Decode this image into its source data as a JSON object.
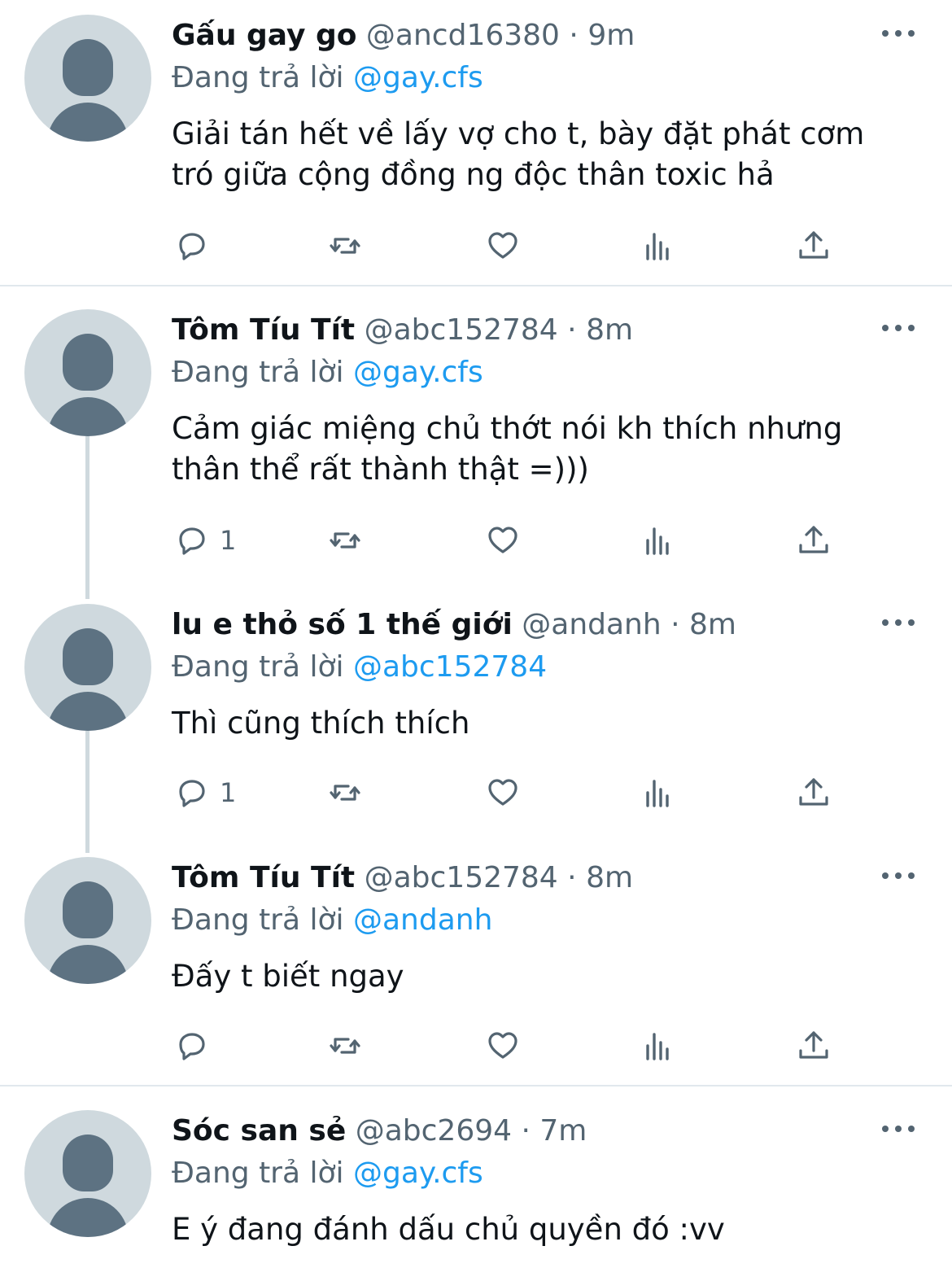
{
  "tweets": [
    {
      "name": "Gấu gay go",
      "handle": "@ancd16380",
      "time": "9m",
      "reply_prefix": "Đang trả lời",
      "reply_to": "@gay.cfs",
      "text": "Giải tán hết về lấy vợ cho t, bày đặt phát cơm tró giữa cộng đồng ng độc thân toxic hả",
      "reply_count": ""
    },
    {
      "name": "Tôm Tíu Tít",
      "handle": "@abc152784",
      "time": "8m",
      "reply_prefix": "Đang trả lời",
      "reply_to": "@gay.cfs",
      "text": "Cảm giác miệng chủ thớt nói kh thích nhưng thân thể rất thành thật =)))",
      "reply_count": "1"
    },
    {
      "name": "lu e thỏ số 1 thế giới",
      "handle": "@andanh",
      "time": "8m",
      "reply_prefix": "Đang trả lời",
      "reply_to": "@abc152784",
      "text": "Thì cũng thích thích",
      "reply_count": "1"
    },
    {
      "name": "Tôm Tíu Tít",
      "handle": "@abc152784",
      "time": "8m",
      "reply_prefix": "Đang trả lời",
      "reply_to": "@andanh",
      "text": "Đấy t biết ngay",
      "reply_count": ""
    },
    {
      "name": "Sóc san sẻ",
      "handle": "@abc2694",
      "time": "7m",
      "reply_prefix": "Đang trả lời",
      "reply_to": "@gay.cfs",
      "text": "E ý đang đánh dấu chủ quyền đó :vv",
      "reply_count": ""
    }
  ],
  "icons": {
    "reply": "reply-icon",
    "retweet": "retweet-icon",
    "like": "like-icon",
    "views": "views-icon",
    "share": "share-icon",
    "more": "more-icon"
  },
  "colors": {
    "text": "#0f1419",
    "secondary": "#536471",
    "link": "#1d9bf0",
    "avatar_bg": "#cfd9de",
    "avatar_fg": "#5d7282",
    "divider": "#e1e8ed"
  }
}
